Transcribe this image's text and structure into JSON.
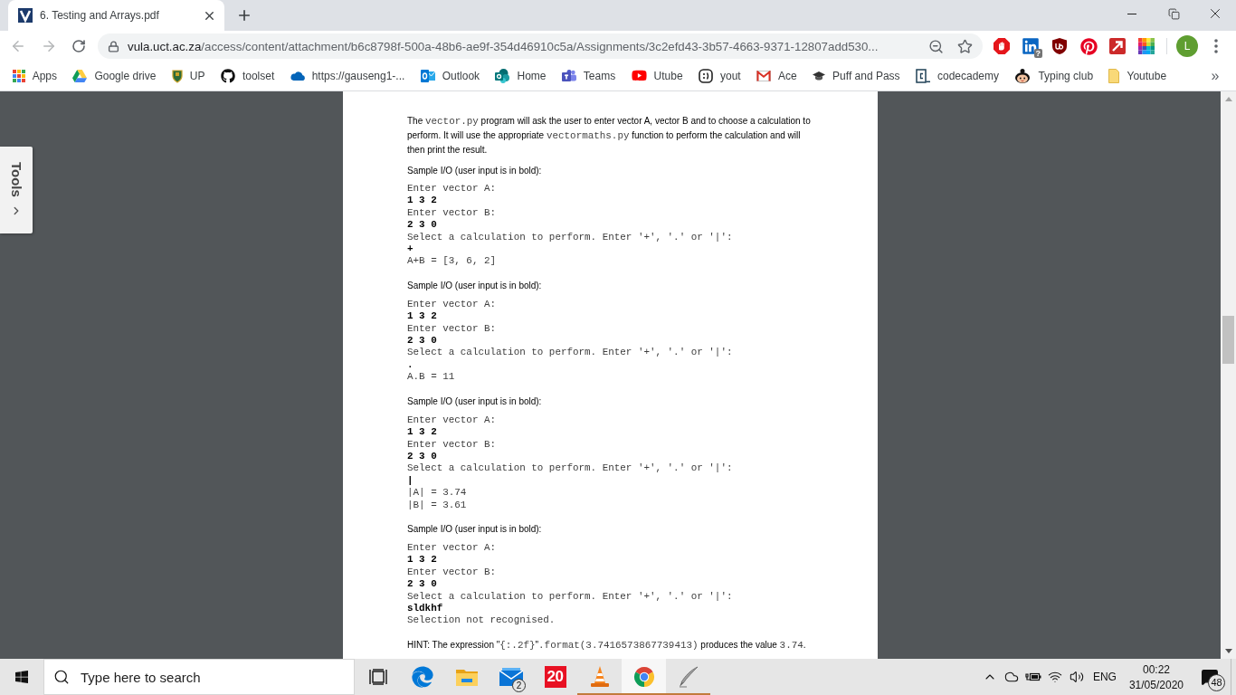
{
  "browser_tabs": [
    {
      "title": "6. Testing and Arrays.pdf",
      "selected": true
    }
  ],
  "toolbar": {
    "nav_buttons": [
      {
        "kind": "back",
        "disabled": true
      },
      {
        "kind": "forward",
        "disabled": true
      },
      {
        "kind": "reload",
        "disabled": false
      }
    ],
    "address": {
      "host": "vula.uct.ac.za",
      "path": "/access/content/attachment/b6c8798f-500a-48b6-ae9f-354d46910c5a/Assignments/3c2efd43-3b57-4663-9371-12807add530..."
    },
    "extensions": [
      {
        "kind": "stop"
      },
      {
        "kind": "linkedin",
        "badge": "?"
      },
      {
        "kind": "shield"
      },
      {
        "kind": "pinterest"
      },
      {
        "kind": "arrow"
      },
      {
        "kind": "palette"
      }
    ],
    "profile": {
      "initial": "L"
    }
  },
  "bookmarks": {
    "items": [
      {
        "kind": "apps",
        "label": "Apps"
      },
      {
        "kind": "drive",
        "label": "Google drive"
      },
      {
        "kind": "crest",
        "label": "UP"
      },
      {
        "kind": "github",
        "label": "toolset"
      },
      {
        "kind": "cloud",
        "label": "https://gauseng1-..."
      },
      {
        "kind": "outlook",
        "label": "Outlook"
      },
      {
        "kind": "sharepoint",
        "label": "Home"
      },
      {
        "kind": "teams",
        "label": "Teams"
      },
      {
        "kind": "youtube",
        "label": "Utube"
      },
      {
        "kind": "smiley",
        "label": "yout"
      },
      {
        "kind": "gmail",
        "label": "Ace"
      },
      {
        "kind": "cap",
        "label": "Puff and Pass"
      },
      {
        "kind": "codecademy",
        "label": "codecademy"
      },
      {
        "kind": "kid",
        "label": "Typing club"
      },
      {
        "kind": "folder",
        "label": "Youtube"
      }
    ],
    "overflow": "»"
  },
  "viewer": {
    "side_panel": {
      "label": "Tools"
    },
    "document": {
      "intro": [
        {
          "kind": "text",
          "text": "The "
        },
        {
          "kind": "code",
          "text": "vector.py"
        },
        {
          "kind": "text",
          "text": " program will ask the user to enter vector A, vector B and to choose a calculation to perform. It will use the appropriate "
        },
        {
          "kind": "code",
          "text": "vectormaths.py"
        },
        {
          "kind": "text",
          "text": " function to perform the calculation and will then print the result."
        }
      ],
      "samples": [
        {
          "heading": "Sample I/O (user input is in bold):",
          "lines": [
            {
              "kind": "output",
              "text": "Enter vector A:"
            },
            {
              "kind": "input",
              "text": "1 3 2"
            },
            {
              "kind": "output",
              "text": "Enter vector B:"
            },
            {
              "kind": "input",
              "text": "2 3 0"
            },
            {
              "kind": "output",
              "text": "Select a calculation to perform. Enter '+', '.' or '|':"
            },
            {
              "kind": "input",
              "text": "+"
            },
            {
              "kind": "output",
              "text": "A+B = [3, 6, 2]"
            }
          ]
        },
        {
          "heading": "Sample I/O (user input is in bold):",
          "lines": [
            {
              "kind": "output",
              "text": "Enter vector A:"
            },
            {
              "kind": "input",
              "text": "1 3 2"
            },
            {
              "kind": "output",
              "text": "Enter vector B:"
            },
            {
              "kind": "input",
              "text": "2 3 0"
            },
            {
              "kind": "output",
              "text": "Select a calculation to perform. Enter '+', '.' or '|':"
            },
            {
              "kind": "input",
              "text": "."
            },
            {
              "kind": "output",
              "text": "A.B = 11"
            }
          ]
        },
        {
          "heading": "Sample I/O (user input is in bold):",
          "lines": [
            {
              "kind": "output",
              "text": "Enter vector A:"
            },
            {
              "kind": "input",
              "text": "1 3 2"
            },
            {
              "kind": "output",
              "text": "Enter vector B:"
            },
            {
              "kind": "input",
              "text": "2 3 0"
            },
            {
              "kind": "output",
              "text": "Select a calculation to perform. Enter '+', '.' or '|':"
            },
            {
              "kind": "input",
              "text": "|"
            },
            {
              "kind": "output",
              "text": "|A| = 3.74"
            },
            {
              "kind": "output",
              "text": "|B| = 3.61"
            }
          ]
        },
        {
          "heading": "Sample I/O (user input is in bold):",
          "lines": [
            {
              "kind": "output",
              "text": "Enter vector A:"
            },
            {
              "kind": "input",
              "text": "1 3 2"
            },
            {
              "kind": "output",
              "text": "Enter vector B:"
            },
            {
              "kind": "input",
              "text": "2 3 0"
            },
            {
              "kind": "output",
              "text": "Select a calculation to perform. Enter '+', '.' or '|':"
            },
            {
              "kind": "input",
              "text": "sldkhf"
            },
            {
              "kind": "output",
              "text": "Selection not recognised."
            }
          ]
        }
      ],
      "hint": [
        {
          "kind": "text",
          "text": "HINT: The expression \""
        },
        {
          "kind": "code",
          "text": "{:.2f}"
        },
        {
          "kind": "text",
          "text": "\""
        },
        {
          "kind": "code",
          "text": ".format(3.7416573867739413)"
        },
        {
          "kind": "text",
          "text": " produces the value "
        },
        {
          "kind": "code",
          "text": "3.74"
        },
        {
          "kind": "text",
          "text": "."
        }
      ]
    }
  },
  "taskbar": {
    "search": {
      "placeholder": "Type here to search"
    },
    "apps": [
      {
        "kind": "taskview",
        "running": false,
        "active": false
      },
      {
        "kind": "edge",
        "running": false,
        "active": false
      },
      {
        "kind": "explorer",
        "running": false,
        "active": false
      },
      {
        "kind": "mail",
        "badge": "2",
        "running": false,
        "active": false
      },
      {
        "kind": "tile",
        "tile": "20",
        "running": false,
        "active": false
      },
      {
        "kind": "vlc",
        "running": true,
        "active": false
      },
      {
        "kind": "chrome",
        "running": true,
        "active": true
      },
      {
        "kind": "pen",
        "running": true,
        "active": false
      }
    ],
    "tray": {
      "language": "ENG",
      "time": "00:22",
      "date": "31/05/2020",
      "notifications": "48"
    }
  }
}
